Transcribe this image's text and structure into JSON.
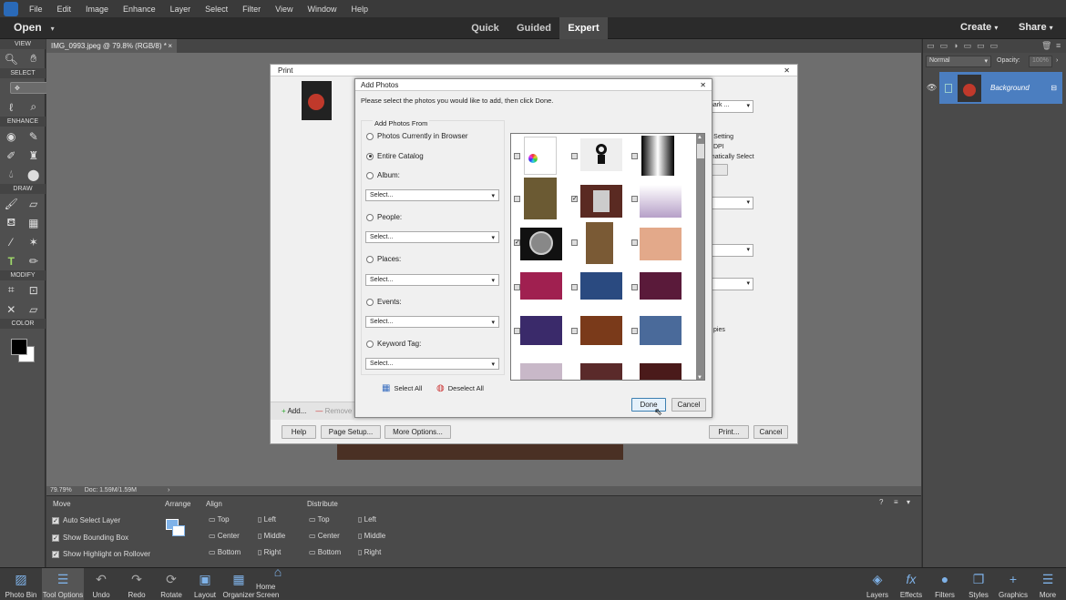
{
  "menubar": {
    "items": [
      "File",
      "Edit",
      "Image",
      "Enhance",
      "Layer",
      "Select",
      "Filter",
      "View",
      "Window",
      "Help"
    ]
  },
  "modebar": {
    "open_label": "Open",
    "modes": [
      "Quick",
      "Guided",
      "Expert"
    ],
    "active_mode": "Expert",
    "create_label": "Create",
    "share_label": "Share"
  },
  "toolbox": {
    "sections": [
      "VIEW",
      "SELECT",
      "ENHANCE",
      "DRAW",
      "MODIFY",
      "COLOR"
    ]
  },
  "document": {
    "tab_title": "IMG_0993.jpeg @ 79.8% (RGB/8) *",
    "zoom": "79.79%",
    "doc_size": "Doc: 1.59M/1.59M"
  },
  "tool_options": {
    "move_header": "Move",
    "arrange_header": "Arrange",
    "align_header": "Align",
    "distribute_header": "Distribute",
    "checkboxes": [
      "Auto Select Layer",
      "Show Bounding Box",
      "Show Highlight on Rollover"
    ],
    "align_items": [
      "Top",
      "Center",
      "Bottom",
      "Left",
      "Middle",
      "Right"
    ],
    "distribute_items": [
      "Top",
      "Center",
      "Bottom",
      "Left",
      "Middle",
      "Right"
    ]
  },
  "bottombar": {
    "left": [
      "Photo Bin",
      "Tool Options",
      "Undo",
      "Redo",
      "Rotate",
      "Layout",
      "Organizer",
      "Home Screen"
    ],
    "right": [
      "Layers",
      "Effects",
      "Filters",
      "Styles",
      "Graphics",
      "More"
    ]
  },
  "layers_panel": {
    "blend_mode": "Normal",
    "opacity_label": "Opacity:",
    "opacity_value": "100%",
    "layer_name": "Background"
  },
  "print_dialog": {
    "title": "Print",
    "add_label": "Add...",
    "remove_label": "Remove",
    "help_label": "Help",
    "page_setup_label": "Page Setup...",
    "more_options_label": "More Options...",
    "print_label": "Print...",
    "cancel_label": "Cancel",
    "fragments": [
      "mark ...",
      "er Setting",
      "DPI",
      "omatically Select",
      "pies"
    ]
  },
  "add_photos_dialog": {
    "title": "Add Photos",
    "instruction": "Please select the photos you would like to add, then click Done.",
    "group_label": "Add Photos From",
    "options": [
      "Photos Currently in Browser",
      "Entire Catalog",
      "Album:",
      "People:",
      "Places:",
      "Events:",
      "Keyword Tag:"
    ],
    "selected_option": "Entire Catalog",
    "select_placeholder": "Select...",
    "select_all_label": "Select All",
    "deselect_all_label": "Deselect All",
    "done_label": "Done",
    "cancel_label": "Cancel"
  },
  "colors": {
    "accent": "#4b7ec0",
    "ui_dark": "#3b3b3b",
    "dialog_bg": "#f0f0f0"
  }
}
